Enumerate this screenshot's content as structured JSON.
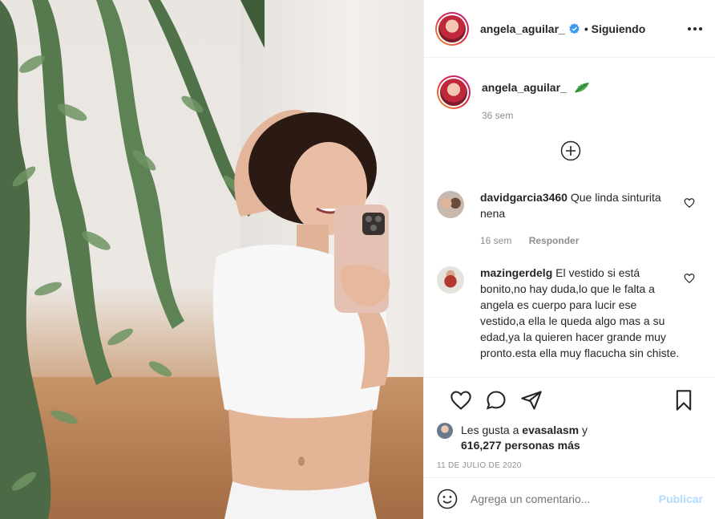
{
  "header": {
    "username": "angela_aguilar_",
    "follow_status": "• Siguiendo",
    "more_icon": "more-horizontal-icon"
  },
  "caption": {
    "username": "angela_aguilar_",
    "emoji": "herb-leaf-emoji",
    "time": "36 sem"
  },
  "load_more_icon": "plus-circle-icon",
  "comments": [
    {
      "username": "davidgarcia3460",
      "text": "Que linda sinturita nena",
      "time": "16 sem",
      "reply_label": "Responder"
    },
    {
      "username": "mazingerdelg",
      "text": "El vestido si está bonito,no hay duda,lo que le falta a angela es cuerpo para lucir ese vestido,a ella le queda algo mas a su edad,ya la quieren hacer grande muy pronto.esta ella muy flacucha sin chiste."
    }
  ],
  "actions": {
    "icons": [
      "heart-icon",
      "comment-icon",
      "share-icon",
      "bookmark-icon"
    ]
  },
  "likes": {
    "prefix": "Les gusta a",
    "user": "evasalasm",
    "joiner": "y",
    "count": "616,277 personas más"
  },
  "date": "11 DE JULIO DE 2020",
  "add_comment": {
    "placeholder": "Agrega un comentario...",
    "publish_label": "Publicar"
  },
  "colors": {
    "text": "#262626",
    "muted": "#8e8e8e",
    "verified": "#3897f0",
    "publish_disabled": "#b3dbff",
    "border": "#efefef"
  }
}
